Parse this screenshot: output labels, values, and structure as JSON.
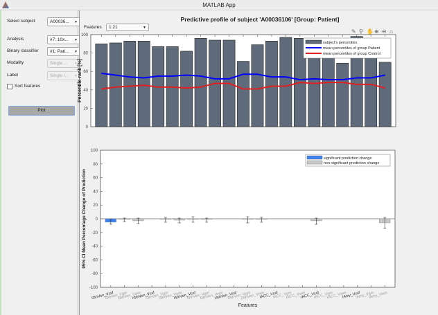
{
  "window": {
    "title": "MATLAB App"
  },
  "sidebar": {
    "select_subject": {
      "label": "Select subject",
      "value": "A00036..."
    },
    "analysis": {
      "label": "Analysis",
      "value": "#7: 10x..."
    },
    "classifier": {
      "label": "Binary classifier",
      "value": "#1: Pati..."
    },
    "modality": {
      "label": "Modality",
      "value": "Single ..."
    },
    "label": {
      "label": "Label",
      "value": "Single l..."
    },
    "sort_features": {
      "label": "Sort features",
      "checked": false
    },
    "plot_label": "Plot"
  },
  "main": {
    "title": "Predictive profile of subject 'A00036106' [Group: Patient]",
    "features_label": "Features",
    "features_value": "1:21",
    "toolbar_icons": [
      "brush-icon",
      "datatip-icon",
      "pan-icon",
      "zoom-in-icon",
      "zoom-out-icon",
      "home-icon"
    ]
  },
  "chart_data": [
    {
      "type": "bar",
      "ylabel": "Percentile rank [%]",
      "ylim": [
        0,
        100
      ],
      "yticks": [
        "0",
        "20",
        "40",
        "60",
        "80",
        "100"
      ],
      "values": [
        90,
        91,
        93,
        93,
        87,
        87,
        82,
        96,
        94,
        94,
        71,
        89,
        93,
        97,
        96,
        88,
        85,
        69,
        98,
        88,
        70
      ],
      "series": [
        {
          "name": "subject's percentiles",
          "color": "#5f6b7a"
        },
        {
          "name": "mean percentiles of group Patient",
          "color": "#0000ff",
          "values": [
            58,
            56,
            54,
            53,
            55,
            55,
            56,
            55,
            52,
            52,
            57,
            57,
            54,
            54,
            51,
            52,
            51,
            51,
            53,
            53,
            56
          ]
        },
        {
          "name": "mean percentiles of group Control",
          "color": "#e02020",
          "values": [
            41,
            43,
            44,
            45,
            43,
            43,
            42,
            43,
            47,
            47,
            41,
            41,
            44,
            44,
            48,
            47,
            48,
            48,
            46,
            46,
            42
          ]
        }
      ],
      "legend": "top-right"
    },
    {
      "type": "bar",
      "xlabel": "Features",
      "ylabel": "95% CI Mean Percentage Change of Prediction",
      "ylim": [
        -100,
        100
      ],
      "yticks": [
        "-100",
        "-80",
        "-60",
        "-40",
        "-20",
        "0",
        "20",
        "40",
        "60",
        "80",
        "100"
      ],
      "categories": [
        "l3thVen_Vcsf",
        "l3thVen_Vgm",
        "l3thVen_Vwm",
        "r3thVen_Vcsf",
        "r3thVen_Vgm",
        "r3thVen_Vwm",
        "l4thVen_Vcsf",
        "l4thVen_Vgm",
        "l4thVen_Vwm",
        "r4thVen_Vcsf",
        "r4thVen_Vgm",
        "r4thVen_Vwm",
        "lACC_Vcsf",
        "lACC_Vgm",
        "lACC_Vwm",
        "rACC_Vcsf",
        "rACC_Vgm",
        "rACC_Vwm",
        "lAmy_Vcsf",
        "lAmy_Vgm",
        "lAmy_Vwm"
      ],
      "values": [
        -5,
        -1,
        -3,
        0,
        -1,
        -2,
        -1,
        -1,
        0,
        0,
        -1,
        -1,
        0,
        0,
        0,
        -3,
        0,
        0,
        0,
        0,
        -6
      ],
      "ci_low": [
        -8,
        -4,
        -7,
        0,
        -5,
        -6,
        -5,
        -5,
        0,
        0,
        -6,
        -5,
        0,
        0,
        0,
        -8,
        0,
        0,
        0,
        0,
        -14
      ],
      "ci_high": [
        -1,
        1,
        1,
        0,
        2,
        1,
        3,
        1,
        0,
        0,
        3,
        2,
        0,
        0,
        0,
        1,
        0,
        0,
        0,
        0,
        2
      ],
      "significant": [
        true,
        false,
        false,
        false,
        false,
        false,
        false,
        false,
        false,
        false,
        false,
        false,
        false,
        false,
        false,
        false,
        false,
        false,
        false,
        false,
        false
      ],
      "series": [
        {
          "name": "significant prediction change",
          "color": "#3b82f0"
        },
        {
          "name": "non-significant prediction change",
          "color": "#c8c8c8"
        }
      ],
      "legend": "top-right"
    }
  ]
}
